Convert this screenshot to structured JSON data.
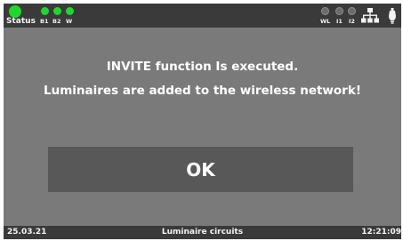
{
  "status_bar": {
    "status_label": "Status",
    "indicators_left": [
      {
        "label": "B1",
        "color": "#22d62b"
      },
      {
        "label": "B2",
        "color": "#22d62b"
      },
      {
        "label": "W",
        "color": "#22d62b"
      }
    ],
    "indicators_right": [
      {
        "label": "WL",
        "state": "off"
      },
      {
        "label": "I1",
        "state": "off"
      },
      {
        "label": "I2",
        "state": "off"
      }
    ],
    "icons": [
      "network-icon",
      "lamp-icon"
    ]
  },
  "dialog": {
    "message_line1": "INVITE function Is executed.",
    "message_line2": "Luminaires are added to the wireless network!",
    "ok_label": "OK"
  },
  "footer": {
    "date": "25.03.21",
    "title": "Luminaire circuits",
    "time": "12:21:09"
  },
  "colors": {
    "bar_background": "#3a3a3a",
    "panel_background": "#7a7a7a",
    "button_background": "#585858",
    "led_green": "#22d62b",
    "led_off": "#6b6b6b"
  }
}
